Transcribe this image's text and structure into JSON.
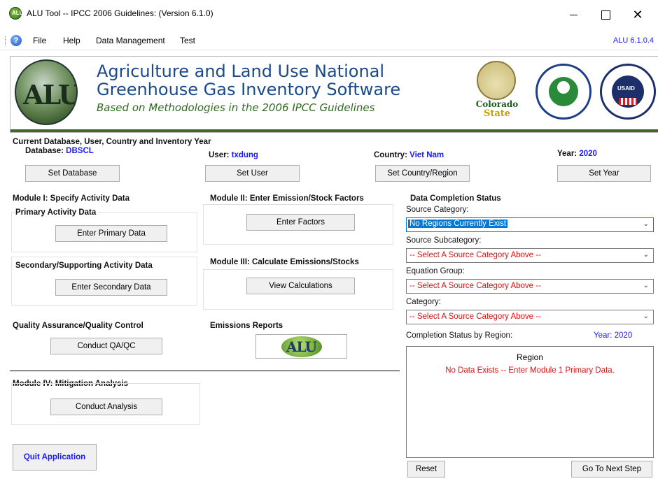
{
  "window": {
    "title": "ALU Tool -- IPCC 2006 Guidelines: (Version 6.1.0)",
    "app_icon_letters": "ALU"
  },
  "menu": {
    "items": [
      "File",
      "Help",
      "Data Management",
      "Test"
    ],
    "version": "ALU 6.1.0.4"
  },
  "banner": {
    "logo_text": "ALU",
    "title_line1": "Agriculture and Land Use National",
    "title_line2": "Greenhouse Gas Inventory Software",
    "subtitle": "Based on Methodologies in the 2006 IPCC Guidelines",
    "csu_line1": "Colorado",
    "csu_line2": "State",
    "usaid_text": "USAID"
  },
  "current": {
    "header": "Current Database, User, Country and Inventory Year",
    "database_label": "Database:",
    "database_value": "DBSCL",
    "user_label": "User:",
    "user_value": "txdung",
    "country_label": "Country:",
    "country_value": "Viet Nam",
    "year_label": "Year:",
    "year_value": "2020",
    "set_database": "Set Database",
    "set_user": "Set User",
    "set_country": "Set Country/Region",
    "set_year": "Set Year"
  },
  "module1": {
    "header": "Module I: Specify Activity Data",
    "primary_label": "Primary Activity Data",
    "primary_button": "Enter Primary Data",
    "secondary_label": "Secondary/Supporting Activity Data",
    "secondary_button": "Enter Secondary Data"
  },
  "module2": {
    "header": "Module II: Enter Emission/Stock Factors",
    "button": "Enter Factors"
  },
  "module3": {
    "header": "Module III: Calculate Emissions/Stocks",
    "button": "View Calculations"
  },
  "qaqc": {
    "header": "Quality Assurance/Quality Control",
    "button": "Conduct QA/QC"
  },
  "emissions": {
    "header": "Emissions Reports",
    "logo_text": "ALU"
  },
  "module4": {
    "header": "Module IV: Mitigation Analysis",
    "button": "Conduct Analysis"
  },
  "quit_button": "Quit Application",
  "status": {
    "header": "Data Completion Status",
    "source_category_label": "Source Category:",
    "source_category_value": "No Regions Currently Exist",
    "source_subcategory_label": "Source Subcategory:",
    "source_subcategory_value": "-- Select A Source Category Above --",
    "equation_group_label": "Equation Group:",
    "equation_group_value": "-- Select A Source Category Above --",
    "category_label": "Category:",
    "category_value": "-- Select A Source Category Above --",
    "completion_label": "Completion Status by Region:",
    "completion_year": "Year: 2020",
    "region_header": "Region",
    "region_message": "No Data Exists -- Enter Module 1 Primary Data.",
    "reset_button": "Reset",
    "next_button": "Go To Next Step"
  }
}
